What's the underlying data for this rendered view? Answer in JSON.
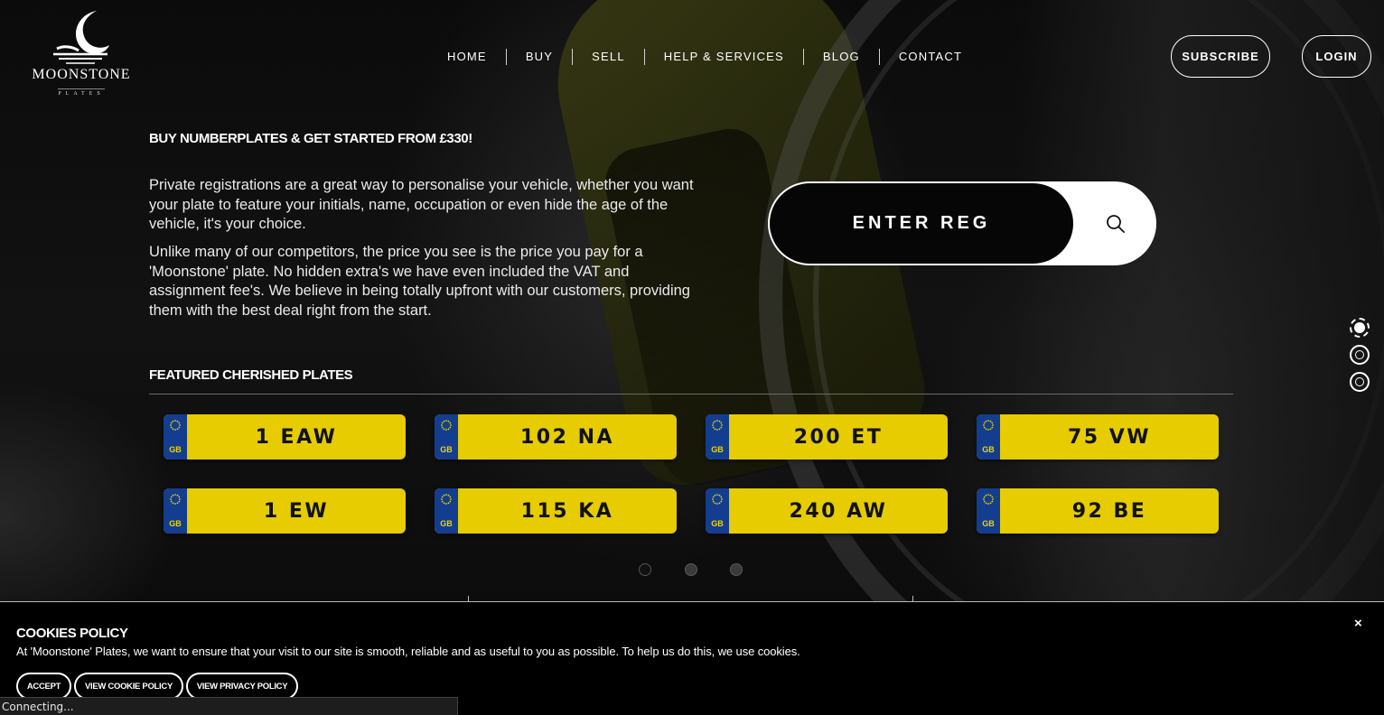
{
  "brand": {
    "name": "MOONSTONE",
    "sub": "PLATES"
  },
  "nav": {
    "items": [
      "HOME",
      "BUY",
      "SELL",
      "HELP & SERVICES",
      "BLOG",
      "CONTACT"
    ],
    "subscribe": "SUBSCRIBE",
    "login": "LOGIN"
  },
  "intro": {
    "headline": "BUY NUMBERPLATES & GET STARTED FROM £330!",
    "para1": "Private registrations are a great way to personalise your vehicle, whether you want your plate to feature your initials, name, occupation or even hide the age of the vehicle, it's your choice.",
    "para2": "Unlike many of our competitors, the price you see is the price you pay for a 'Moonstone' plate. No hidden extra's we have even included the VAT and assignment fee's. We believe in being totally upfront with our customers, providing them with the best deal right from the start."
  },
  "search": {
    "placeholder": "ENTER REG",
    "icon": "search-icon"
  },
  "featured": {
    "title": "FEATURED CHERISHED PLATES",
    "plates": [
      {
        "reg": "1 EAW",
        "country": "GB"
      },
      {
        "reg": "102 NA",
        "country": "GB"
      },
      {
        "reg": "200 ET",
        "country": "GB"
      },
      {
        "reg": "75 VW",
        "country": "GB"
      },
      {
        "reg": "1 EW",
        "country": "GB"
      },
      {
        "reg": "115 KA",
        "country": "GB"
      },
      {
        "reg": "240 AW",
        "country": "GB"
      },
      {
        "reg": "92 BE",
        "country": "GB"
      }
    ],
    "pager": {
      "pages": 3,
      "current": 1
    }
  },
  "side_nav": {
    "sections": 3,
    "current": 1
  },
  "cookies": {
    "title": "COOKIES POLICY",
    "text": "At 'Moonstone' Plates, we want to ensure that your visit to our site is smooth, reliable and as useful to you as possible. To help us do this, we use cookies.",
    "close": "×",
    "accept": "ACCEPT",
    "view_cookie": "VIEW COOKIE POLICY",
    "view_privacy": "VIEW PRIVACY POLICY"
  },
  "status_bar": "Connecting...",
  "colors": {
    "plate_yellow": "#e6cc00",
    "plate_band": "#133e8f",
    "background": "#070707"
  }
}
